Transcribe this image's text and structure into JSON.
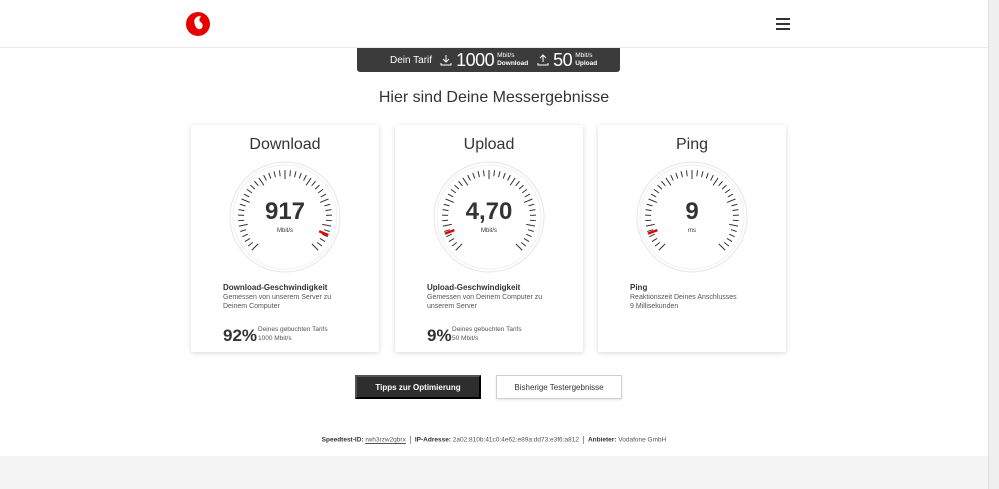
{
  "brand": {
    "name": "Vodafone",
    "color": "#e60000"
  },
  "tarif": {
    "label": "Dein Tarif",
    "download_value": "1000",
    "download_unit": "Mbit/s",
    "download_label": "Download",
    "upload_value": "50",
    "upload_unit": "Mbit/s",
    "upload_label": "Upload"
  },
  "page_title": "Hier sind Deine Messergebnisse",
  "cards": [
    {
      "title": "Download",
      "value": "917",
      "unit": "Mbit/s",
      "gauge_fraction": 0.917,
      "desc_title": "Download-Geschwindigkeit",
      "desc_text": "Gemessen von unserem Server zu Deinem Computer",
      "percent": "92%",
      "percent_line1": "Deines gebuchten Tarifs",
      "percent_line2": "1000 Mbit/s"
    },
    {
      "title": "Upload",
      "value": "4,70",
      "unit": "Mbit/s",
      "gauge_fraction": 0.09,
      "desc_title": "Upload-Geschwindigkeit",
      "desc_text": "Gemessen von Deinem Computer zu unserem Server",
      "percent": "9%",
      "percent_line1": "Deines gebuchten Tarifs",
      "percent_line2": "50 Mbit/s"
    },
    {
      "title": "Ping",
      "value": "9",
      "unit": "ms",
      "gauge_fraction": 0.09,
      "desc_title": "Ping",
      "desc_text": "Reaktionszeit Deines Anschlusses",
      "desc_text2": "9 Millisekunden"
    }
  ],
  "buttons": {
    "tips": "Tipps zur Optimierung",
    "history": "Bisherige Testergebnisse"
  },
  "footer": {
    "speedtest_label": "Speedtest-ID:",
    "speedtest_id": "rwh3rzw2qbrx",
    "ip_label": "IP-Adresse:",
    "ip_value": "2a02:810b:41c0:4e62:e89a:dd73:e3f6:a812",
    "provider_label": "Anbieter:",
    "provider_value": "Vodafone GmbH"
  },
  "colors": {
    "dark_button": "#2e2e2e",
    "gauge_tick": "#333333",
    "gauge_needle": "#e60000"
  }
}
